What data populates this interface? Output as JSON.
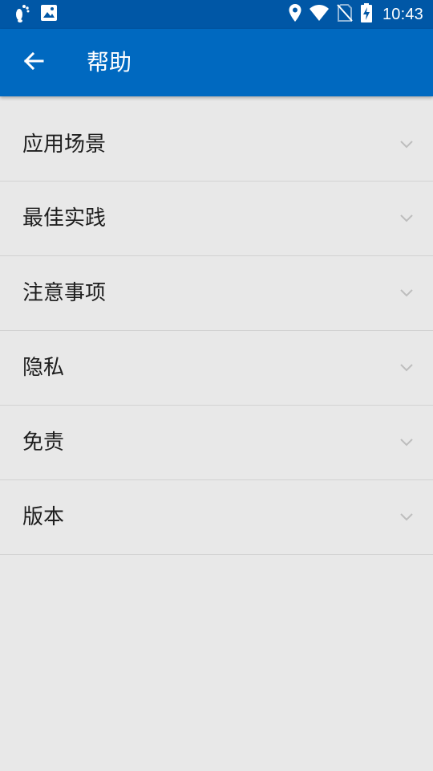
{
  "status_bar": {
    "time": "10:43",
    "left_icons": [
      "footprint-icon",
      "image-icon"
    ],
    "right_icons": [
      "location-icon",
      "wifi-icon",
      "no-sim-icon",
      "battery-charging-icon"
    ]
  },
  "app_bar": {
    "back_icon": "arrow-back-icon",
    "title": "帮助"
  },
  "colors": {
    "status_bar": "#0057a6",
    "app_bar": "#0069c0",
    "background": "#e8e8e8",
    "divider": "#d2d2d2",
    "chevron": "#bdbdbd"
  },
  "help_items": [
    {
      "label": "应用场景"
    },
    {
      "label": "最佳实践"
    },
    {
      "label": "注意事项"
    },
    {
      "label": "隐私"
    },
    {
      "label": "免责"
    },
    {
      "label": "版本"
    }
  ]
}
